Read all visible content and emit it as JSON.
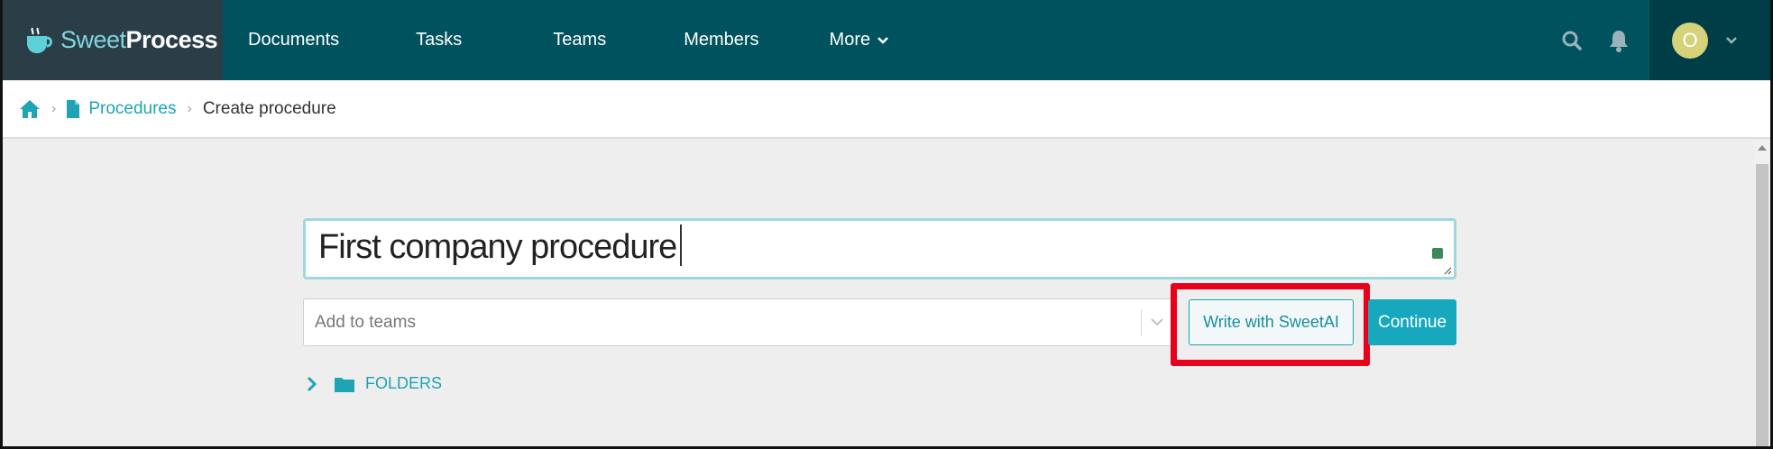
{
  "app": {
    "logo_sweet": "Sweet",
    "logo_process": "Process"
  },
  "nav": {
    "items": [
      {
        "label": "Documents"
      },
      {
        "label": "Tasks"
      },
      {
        "label": "Teams"
      },
      {
        "label": "Members"
      },
      {
        "label": "More"
      }
    ],
    "user_initial": "O"
  },
  "breadcrumb": {
    "procedures": "Procedures",
    "current": "Create procedure"
  },
  "form": {
    "title_value": "First company procedure",
    "teams_placeholder": "Add to teams",
    "sweetai_label": "Write with SweetAI",
    "continue_label": "Continue",
    "folders_label": "FOLDERS"
  },
  "colors": {
    "nav_bg": "#00525e",
    "logo_bg": "#2b3d47",
    "accent": "#1ea4b5",
    "highlight": "#e8001c"
  }
}
